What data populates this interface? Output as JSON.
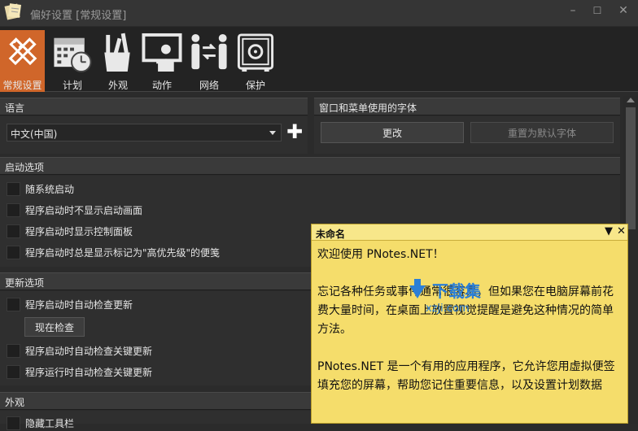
{
  "window": {
    "title": "偏好设置 [常规设置]",
    "minimize": "–",
    "maximize": "☐",
    "close": "✕"
  },
  "toolbar": {
    "items": [
      {
        "label": "常规设置",
        "icon": "ruler-pencil-icon",
        "active": true
      },
      {
        "label": "计划",
        "icon": "calendar-clock-icon"
      },
      {
        "label": "外观",
        "icon": "brush-cup-icon"
      },
      {
        "label": "动作",
        "icon": "monitor-person-icon"
      },
      {
        "label": "网络",
        "icon": "people-network-icon"
      },
      {
        "label": "保护",
        "icon": "safe-icon"
      }
    ]
  },
  "language": {
    "header": "语言",
    "selected": "中文(中国)",
    "add": "✚"
  },
  "font": {
    "header": "窗口和菜单使用的字体",
    "change_label": "更改",
    "reset_label": "重置为默认字体"
  },
  "startup": {
    "header": "启动选项",
    "options": [
      "随系统启动",
      "程序启动时不显示启动画面",
      "程序启动时显示控制面板",
      "程序启动时总是显示标记为\"高优先级\"的便笺"
    ]
  },
  "update": {
    "header": "更新选项",
    "options": [
      "程序启动时自动检查更新",
      "程序启动时自动检查关键更新",
      "程序运行时自动检查关键更新"
    ],
    "check_now_label": "现在检查"
  },
  "appearance": {
    "header": "外观",
    "options": [
      "隐藏工具栏"
    ]
  },
  "note": {
    "title": "未命名",
    "dropdown": "▼",
    "close": "✕",
    "paragraphs": [
      "欢迎使用 PNotes.NET！",
      "忘记各种任务或事件通常很容易，但如果您在电脑屏幕前花费大量时间，在桌面上放置视觉提醒是避免这种情况的简单方法。",
      "PNotes.NET 是一个有用的应用程序，它允许您用虚拟便签填充您的屏幕，帮助您记住重要信息，以及设置计划数据"
    ]
  },
  "watermark": {
    "text": "下载集",
    "url": "xzji.com"
  },
  "colors": {
    "accent": "#d0662a",
    "note_bg": "#f5dd6b",
    "window_bg": "#2b2b2b"
  }
}
